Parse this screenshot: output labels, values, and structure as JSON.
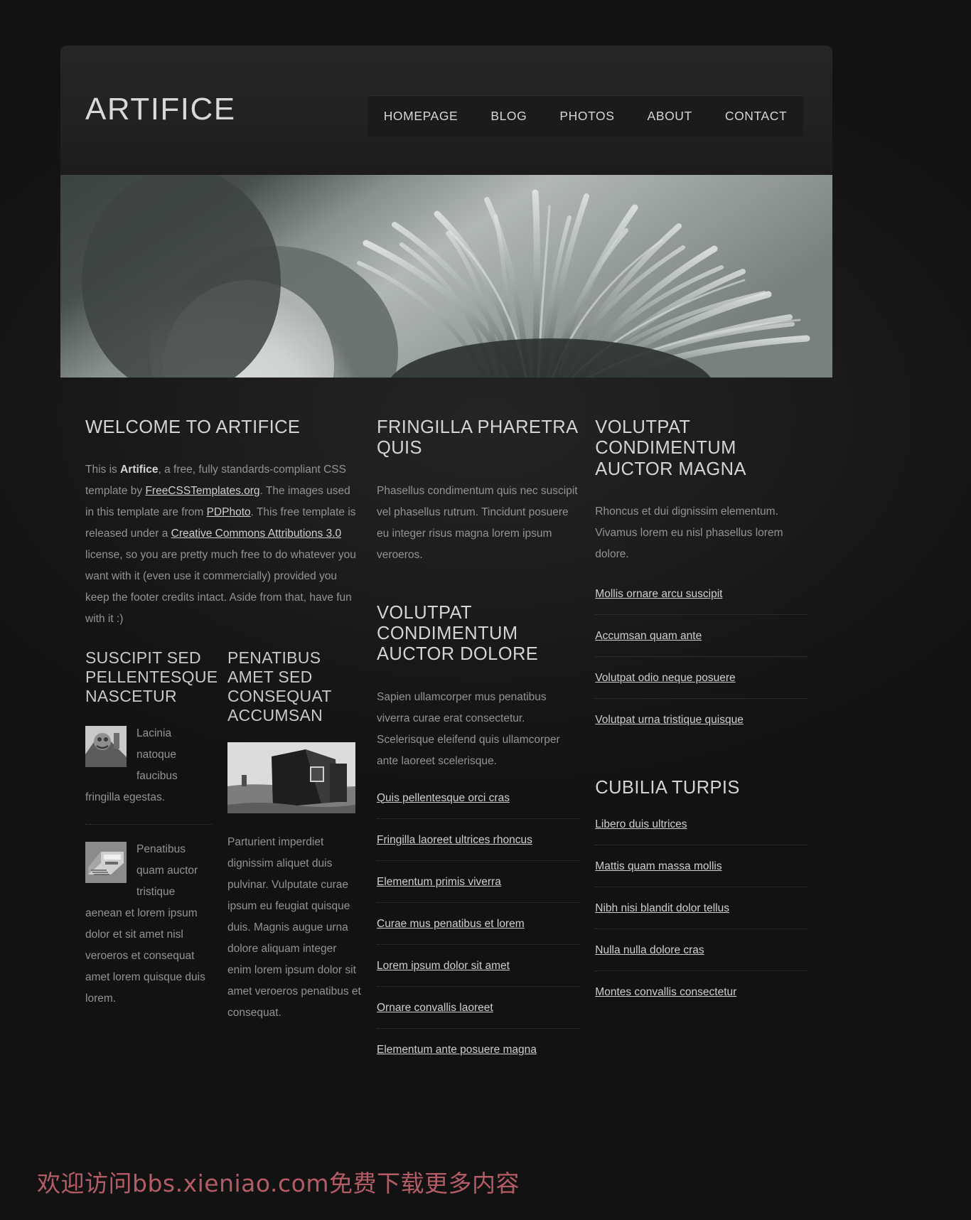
{
  "site": {
    "logo": "ARTIFICE",
    "accent_color": "#d4d4d4",
    "background_color": "#191919",
    "watermark": "欢迎访问bbs.xieniao.com免费下载更多内容",
    "watermark_color": "#c2636d"
  },
  "nav": {
    "items": [
      {
        "label": "HOMEPAGE"
      },
      {
        "label": "BLOG"
      },
      {
        "label": "PHOTOS"
      },
      {
        "label": "ABOUT"
      },
      {
        "label": "CONTACT"
      }
    ]
  },
  "banner": {
    "alt": "grayscale close-up of a pincushion protea flower"
  },
  "welcome": {
    "heading": "WELCOME TO ARTIFICE",
    "p_1": "This is ",
    "p_strong": "Artifice",
    "p_2": ", a free, fully standards-compliant CSS template by ",
    "link_1": "FreeCSSTemplates.org",
    "p_3": ". The images used in this template are from ",
    "link_2": "PDPhoto",
    "p_4": ". This free template is released under a ",
    "link_3": "Creative Commons Attributions 3.0",
    "p_5": " license, so you are pretty much free to do whatever you want with it (even use it commercially) provided you keep the footer credits intact. Aside from that, have fun with it :)"
  },
  "suscipit": {
    "heading": "SUSCIPIT SED PELLENTESQUE NASCETUR",
    "blurbs": [
      {
        "text": "Lacinia natoque faucibus fringilla egestas.",
        "image": "stone-carving-thumb"
      },
      {
        "text": "Penatibus quam auctor tristique aenean et lorem ipsum dolor et sit amet nisl veroeros et consequat amet lorem quisque duis lorem.",
        "image": "machinery-thumb"
      }
    ]
  },
  "penatibus": {
    "heading": "PENATIBUS AMET SED CONSEQUAT ACCUMSAN",
    "image": "barn-photo",
    "body": "Parturient imperdiet dignissim aliquet duis pulvinar. Vulputate curae ipsum eu feugiat quisque duis. Magnis augue urna dolore aliquam integer enim lorem ipsum dolor sit amet veroeros penatibus et consequat."
  },
  "fringilla": {
    "heading": "FRINGILLA PHARETRA QUIS",
    "body": "Phasellus condimentum quis nec suscipit vel phasellus rutrum. Tincidunt posuere eu integer risus magna lorem ipsum veroeros."
  },
  "volutpat_dolore": {
    "heading": "VOLUTPAT CONDIMENTUM AUCTOR DOLORE",
    "body": "Sapien ullamcorper mus penatibus viverra curae erat consectetur. Scelerisque eleifend quis ullamcorper ante laoreet scelerisque.",
    "links": [
      {
        "label": "Quis pellentesque orci cras"
      },
      {
        "label": "Fringilla laoreet ultrices rhoncus"
      },
      {
        "label": "Elementum primis viverra"
      },
      {
        "label": "Curae mus penatibus et lorem"
      },
      {
        "label": "Lorem ipsum dolor sit amet"
      },
      {
        "label": "Ornare convallis laoreet"
      },
      {
        "label": "Elementum ante posuere magna"
      }
    ]
  },
  "volutpat_magna": {
    "heading": "VOLUTPAT CONDIMENTUM AUCTOR MAGNA",
    "body": "Rhoncus et dui dignissim elementum. Vivamus lorem eu nisl phasellus lorem dolore.",
    "links": [
      {
        "label": "Mollis ornare arcu suscipit"
      },
      {
        "label": "Accumsan quam ante"
      },
      {
        "label": "Volutpat odio neque posuere"
      },
      {
        "label": "Volutpat urna tristique quisque"
      }
    ]
  },
  "cubilia": {
    "heading": "CUBILIA TURPIS",
    "links": [
      {
        "label": "Libero duis ultrices"
      },
      {
        "label": "Mattis quam massa mollis"
      },
      {
        "label": "Nibh nisi blandit dolor tellus"
      },
      {
        "label": "Nulla nulla dolore cras"
      },
      {
        "label": "Montes convallis consectetur"
      }
    ]
  }
}
